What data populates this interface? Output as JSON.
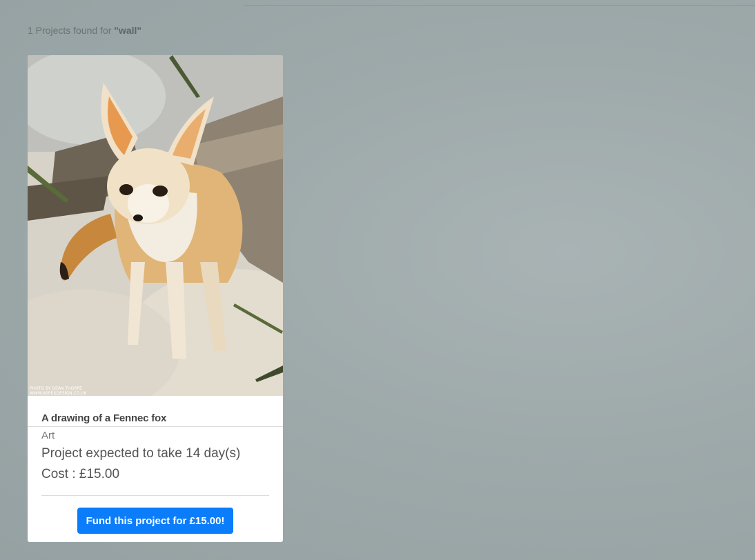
{
  "search": {
    "results_text": "1 Projects found for ",
    "query": "\"wall\""
  },
  "project_card": {
    "image_alt": "Fennec fox photo",
    "photo_credit_line1": "PHOTO BY DEAN THORPE",
    "photo_credit_line2": "WWW.ASPEXDESIGN.CO.UK",
    "title": "A drawing of a Fennec fox",
    "category": "Art",
    "duration": "Project expected to take 14 day(s)",
    "cost": "Cost : £15.00",
    "fund_button_label": "Fund this project for £15.00!"
  },
  "colors": {
    "button": "#0b7dfb",
    "background": "#9ea9aa"
  }
}
